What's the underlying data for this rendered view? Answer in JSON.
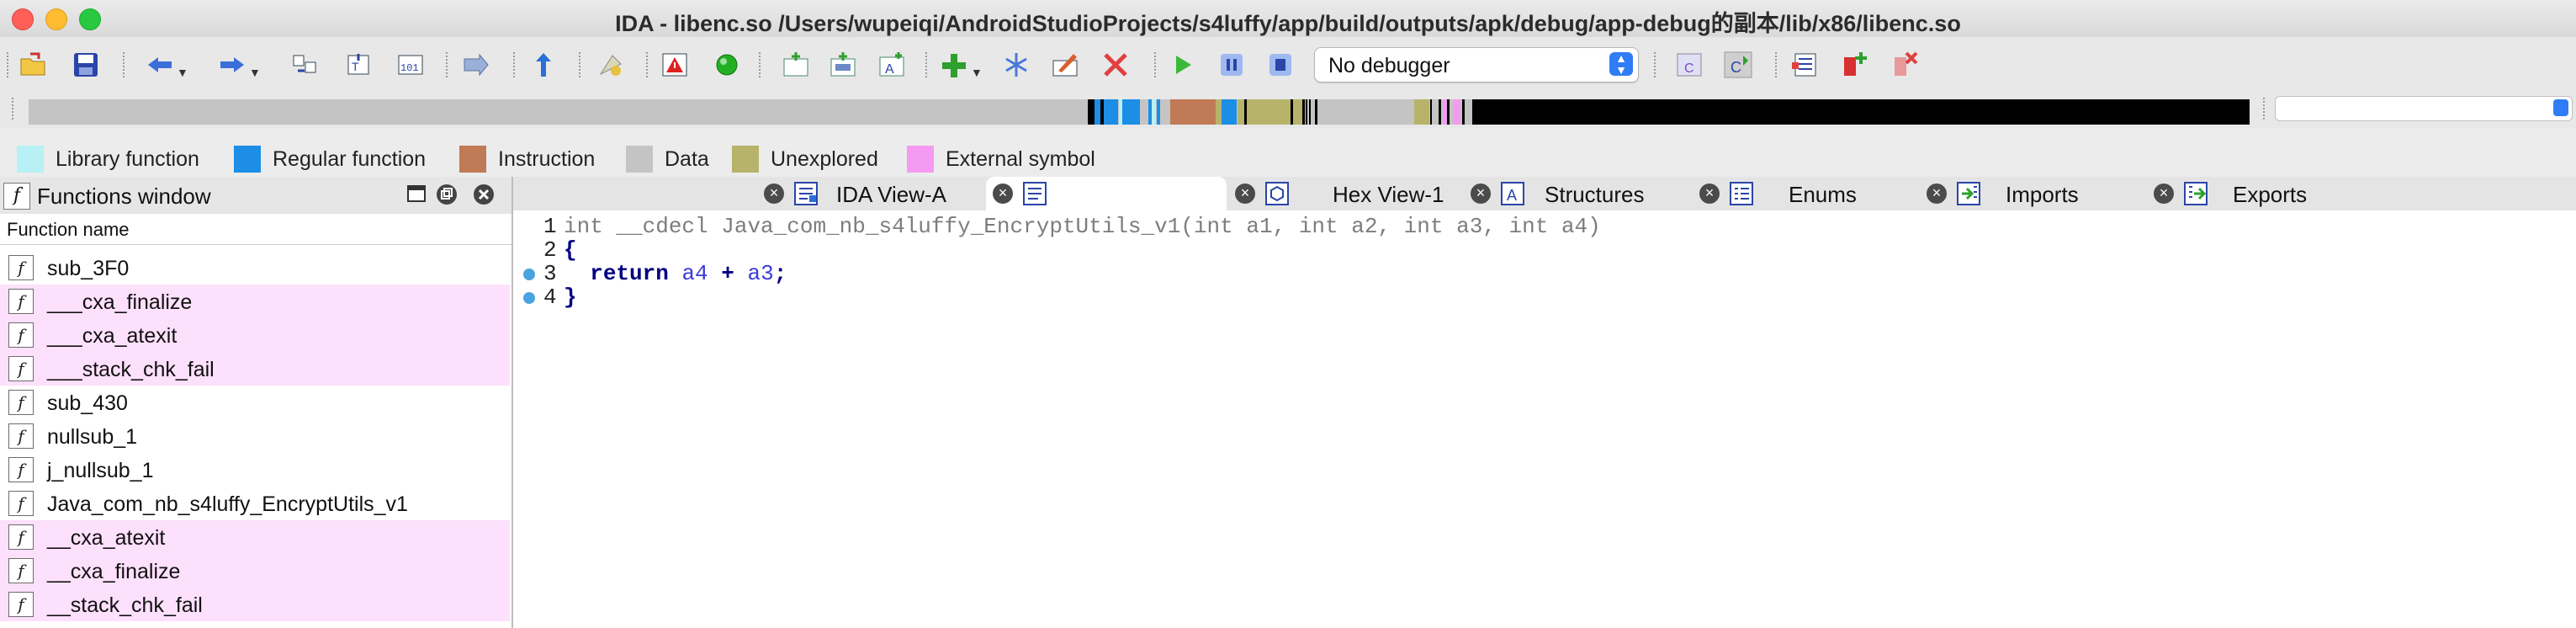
{
  "window": {
    "title": "IDA - libenc.so /Users/wupeiqi/AndroidStudioProjects/s4luffy/app/build/outputs/apk/debug/app-debug的副本/lib/x86/libenc.so"
  },
  "toolbar": {
    "debugger": {
      "selected": "No debugger"
    },
    "icons": [
      "open-icon",
      "save-icon",
      "back-icon",
      "forward-icon",
      "jump-icon",
      "search-text-icon",
      "search-binary-icon",
      "segment-icon",
      "up-arrow-icon",
      "flag-icon",
      "warning-icon",
      "green-circle-icon",
      "code-icon",
      "data-icon",
      "string-icon",
      "add-icon",
      "snowflake-icon",
      "edit-icon",
      "delete-icon",
      "run-icon",
      "pause-icon",
      "stop-icon",
      "graph-icon",
      "refresh-icon",
      "list-icon",
      "breakpoint-add-icon",
      "breakpoint-delete-icon"
    ]
  },
  "navigation": {
    "colors": {
      "library": "#b7f0f5",
      "regular": "#1c8ee6",
      "instruction": "#c07a55",
      "data": "#c4c4c4",
      "unexplored": "#b7b36a",
      "external": "#f59af2",
      "black": "#000000"
    }
  },
  "legend": [
    {
      "label": "Library function",
      "color": "#b7f0f5"
    },
    {
      "label": "Regular function",
      "color": "#1c8ee6"
    },
    {
      "label": "Instruction",
      "color": "#c07a55"
    },
    {
      "label": "Data",
      "color": "#c4c4c4"
    },
    {
      "label": "Unexplored",
      "color": "#b7b36a"
    },
    {
      "label": "External symbol",
      "color": "#f59af2"
    }
  ],
  "functions_window": {
    "title": "Functions window",
    "column_header": "Function name",
    "highlight_color": "#fde0fc",
    "functions": [
      {
        "name": "sub_3F0",
        "external": false
      },
      {
        "name": "___cxa_finalize",
        "external": true
      },
      {
        "name": "___cxa_atexit",
        "external": true
      },
      {
        "name": "___stack_chk_fail",
        "external": true
      },
      {
        "name": "sub_430",
        "external": false
      },
      {
        "name": "nullsub_1",
        "external": false
      },
      {
        "name": "j_nullsub_1",
        "external": false
      },
      {
        "name": "Java_com_nb_s4luffy_EncryptUtils_v1",
        "external": false
      },
      {
        "name": "__cxa_atexit",
        "external": true
      },
      {
        "name": "__cxa_finalize",
        "external": true
      },
      {
        "name": "__stack_chk_fail",
        "external": true
      }
    ]
  },
  "tabs": [
    {
      "label": "IDA View-A",
      "active": false,
      "icon": "ida-view-icon"
    },
    {
      "label": "",
      "active": true,
      "icon": "pseudocode-icon"
    },
    {
      "label": "Hex View-1",
      "active": false,
      "icon": "hex-icon"
    },
    {
      "label": "Structures",
      "active": false,
      "icon": "structures-icon"
    },
    {
      "label": "Enums",
      "active": false,
      "icon": "enums-icon"
    },
    {
      "label": "Imports",
      "active": false,
      "icon": "imports-icon"
    },
    {
      "label": "Exports",
      "active": false,
      "icon": "exports-icon"
    }
  ],
  "pseudocode": {
    "lines": [
      {
        "num": "1",
        "text": "int __cdecl Java_com_nb_s4luffy_EncryptUtils_v1(int a1, int a2, int a3, int a4)",
        "breakpoint": false
      },
      {
        "num": "2",
        "text": "{",
        "breakpoint": false
      },
      {
        "num": "3",
        "text": "  return a4 + a3;",
        "breakpoint": true
      },
      {
        "num": "4",
        "text": "}",
        "breakpoint": true
      }
    ]
  }
}
